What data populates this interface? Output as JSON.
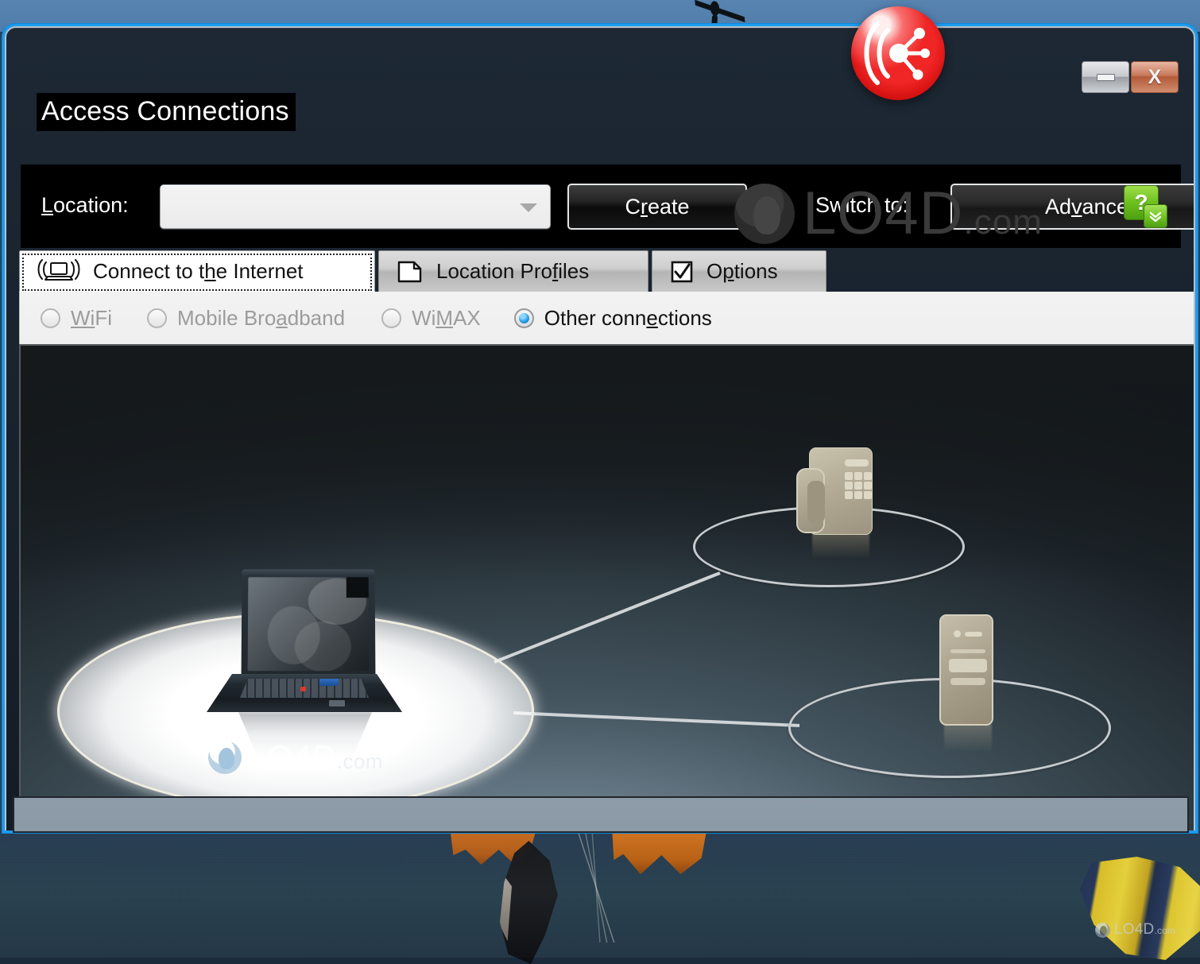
{
  "window": {
    "app_title": "Access Connections",
    "app_icon": "access-connections-logo-icon",
    "minimize_label": "–",
    "close_label": "X"
  },
  "toolbar": {
    "location_label_pre": "",
    "location_label_key": "L",
    "location_label_post": "ocation:",
    "location_value": "",
    "location_placeholder": "",
    "create_pre": "C",
    "create_key": "r",
    "create_post": "eate",
    "switch_to_label": "Switch to:",
    "advanced_pre": "Ad",
    "advanced_key": "v",
    "advanced_post": "anced",
    "help_label": "?",
    "help_icon": "help-question-icon",
    "help_dropdown_icon": "chevron-double-down-icon"
  },
  "tabs": [
    {
      "id": "connect",
      "pre": "Connect to t",
      "key": "h",
      "post": "e Internet",
      "icon": "laptop-wireless-icon",
      "active": true
    },
    {
      "id": "profiles",
      "pre": "Location Pro",
      "key": "f",
      "post": "iles",
      "icon": "page-document-icon",
      "active": false
    },
    {
      "id": "options",
      "pre": "O",
      "key": "p",
      "post": "tions",
      "icon": "checkbox-checked-icon",
      "active": false
    }
  ],
  "connection_types": [
    {
      "id": "wifi",
      "pre": "W",
      "key": "i",
      "post": "Fi",
      "checked": false,
      "enabled": false
    },
    {
      "id": "mobile",
      "pre": "Mobile Bro",
      "key": "a",
      "post": "dband",
      "checked": false,
      "enabled": false
    },
    {
      "id": "wimax",
      "pre": "Wi",
      "key": "M",
      "post": "AX",
      "checked": false,
      "enabled": false
    },
    {
      "id": "other",
      "pre": "Other conn",
      "key": "e",
      "post": "ctions",
      "checked": true,
      "enabled": true
    }
  ],
  "diagram": {
    "nodes": [
      {
        "id": "laptop",
        "icon": "laptop-icon",
        "highlighted": true
      },
      {
        "id": "phone",
        "icon": "telephone-modem-icon",
        "highlighted": false
      },
      {
        "id": "tower",
        "icon": "desktop-tower-icon",
        "highlighted": false
      }
    ],
    "links": [
      {
        "from": "laptop",
        "to": "phone"
      },
      {
        "from": "laptop",
        "to": "tower"
      }
    ]
  },
  "watermarks": {
    "brand": "LO4D",
    "suffix": ".com",
    "logo_icon": "lo4d-logo-icon"
  },
  "colors": {
    "accent_blue": "#1b9cf0",
    "window_bg": "#1d2834",
    "toolbar_bg": "#000000",
    "tab_active_bg": "#ffffff",
    "radio_checked": "#2aa3e8",
    "close_button": "#c97a5c",
    "app_icon_red": "#f02525",
    "help_green": "#6fc21f"
  }
}
